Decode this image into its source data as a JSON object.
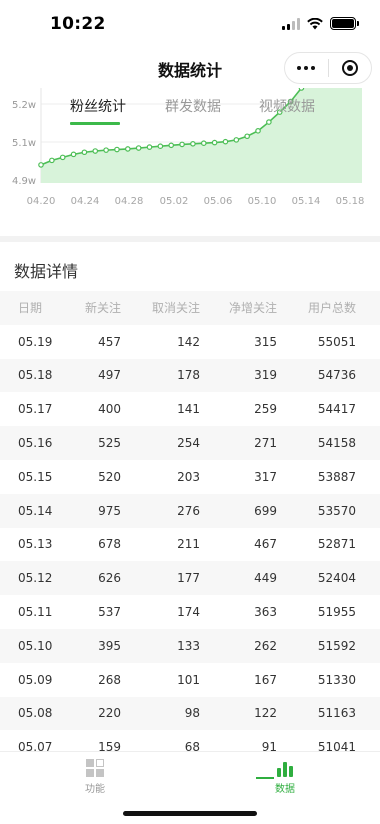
{
  "status_bar": {
    "time": "10:22"
  },
  "nav": {
    "title": "数据统计"
  },
  "chart_tabs": [
    {
      "label": "粉丝统计",
      "active": true
    },
    {
      "label": "群发数据",
      "active": false
    },
    {
      "label": "视频数据",
      "active": false
    }
  ],
  "chart_data": {
    "type": "area",
    "x": [
      "04.20",
      "04.21",
      "04.22",
      "04.23",
      "04.24",
      "04.25",
      "04.26",
      "04.27",
      "04.28",
      "04.29",
      "04.30",
      "05.01",
      "05.02",
      "05.03",
      "05.04",
      "05.05",
      "05.06",
      "05.07",
      "05.08",
      "05.09",
      "05.10",
      "05.11",
      "05.12",
      "05.13",
      "05.14"
    ],
    "y": [
      49400,
      49550,
      49650,
      49750,
      49820,
      49860,
      49890,
      49910,
      49930,
      49960,
      49990,
      50020,
      50050,
      50080,
      50100,
      50120,
      50140,
      50170,
      50230,
      50350,
      50530,
      50820,
      51150,
      51500,
      51950
    ],
    "yticks": [
      "4.9w",
      "5.1w",
      "5.2w"
    ],
    "xticks": [
      "04.20",
      "04.24",
      "04.28",
      "05.02",
      "05.06",
      "05.10",
      "05.14",
      "05.18"
    ],
    "ylim": [
      48800,
      51950
    ],
    "line_color": "#4cbe55",
    "fill_color": "#d8f3da"
  },
  "detail": {
    "title": "数据详情",
    "columns": [
      "日期",
      "新关注",
      "取消关注",
      "净增关注",
      "用户总数"
    ],
    "rows": [
      [
        "05.19",
        "457",
        "142",
        "315",
        "55051"
      ],
      [
        "05.18",
        "497",
        "178",
        "319",
        "54736"
      ],
      [
        "05.17",
        "400",
        "141",
        "259",
        "54417"
      ],
      [
        "05.16",
        "525",
        "254",
        "271",
        "54158"
      ],
      [
        "05.15",
        "520",
        "203",
        "317",
        "53887"
      ],
      [
        "05.14",
        "975",
        "276",
        "699",
        "53570"
      ],
      [
        "05.13",
        "678",
        "211",
        "467",
        "52871"
      ],
      [
        "05.12",
        "626",
        "177",
        "449",
        "52404"
      ],
      [
        "05.11",
        "537",
        "174",
        "363",
        "51955"
      ],
      [
        "05.10",
        "395",
        "133",
        "262",
        "51592"
      ],
      [
        "05.09",
        "268",
        "101",
        "167",
        "51330"
      ],
      [
        "05.08",
        "220",
        "98",
        "122",
        "51163"
      ],
      [
        "05.07",
        "159",
        "68",
        "91",
        "51041"
      ]
    ]
  },
  "tab_bar": {
    "items": [
      {
        "label": "功能",
        "icon": "grid-icon",
        "active": false
      },
      {
        "label": "数据",
        "icon": "bar-chart-icon",
        "active": true
      }
    ],
    "active_color": "#2fae3f",
    "inactive_color": "#999999"
  }
}
